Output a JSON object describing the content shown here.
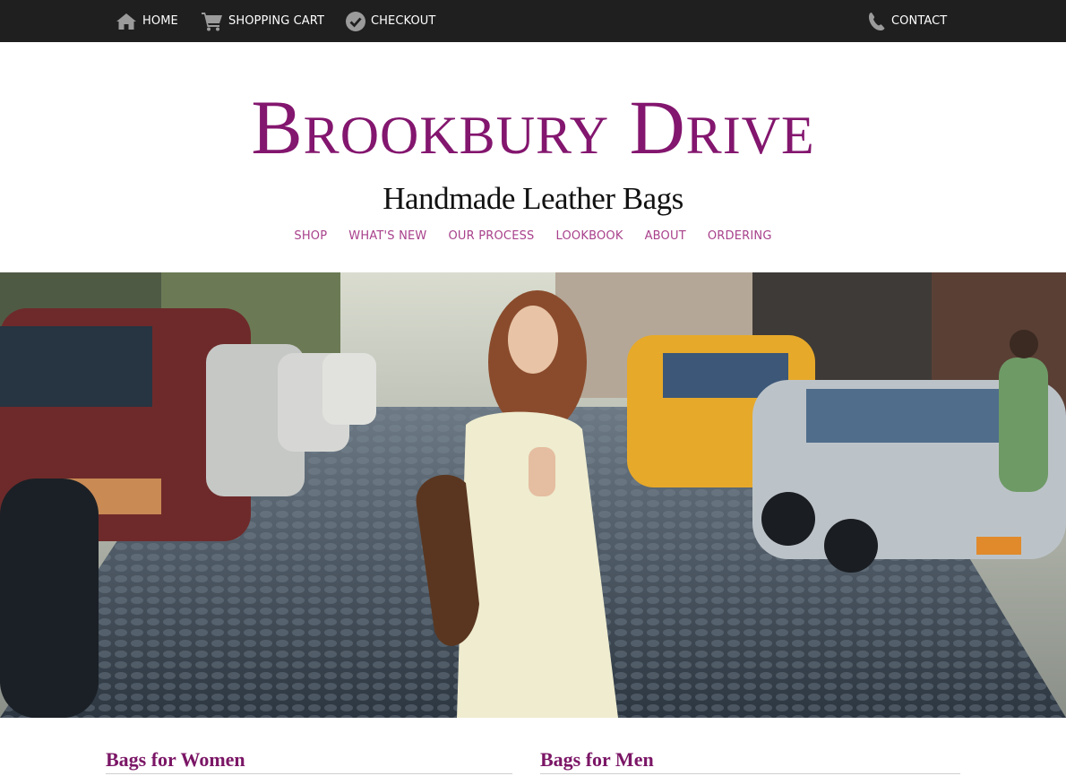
{
  "topnav": {
    "home": {
      "label": "HOME",
      "icon": "home-icon"
    },
    "cart": {
      "label": "SHOPPING CART",
      "icon": "cart-icon"
    },
    "checkout": {
      "label": "CHECKOUT",
      "icon": "checkmark-circle-icon"
    },
    "contact": {
      "label": "CONTACT",
      "icon": "phone-icon"
    }
  },
  "header": {
    "title": "Brookbury Drive",
    "tagline": "Handmade Leather Bags"
  },
  "mainnav": {
    "items": [
      {
        "label": "SHOP"
      },
      {
        "label": "WHAT'S NEW"
      },
      {
        "label": "OUR PROCESS"
      },
      {
        "label": "LOOKBOOK"
      },
      {
        "label": "ABOUT"
      },
      {
        "label": "ORDERING"
      }
    ]
  },
  "sections": {
    "women": {
      "title": "Bags for Women"
    },
    "men": {
      "title": "Bags for Men"
    }
  },
  "colors": {
    "brand": "#83166e",
    "nav_link": "#a8418b",
    "topbar": "#1f1f1f"
  }
}
